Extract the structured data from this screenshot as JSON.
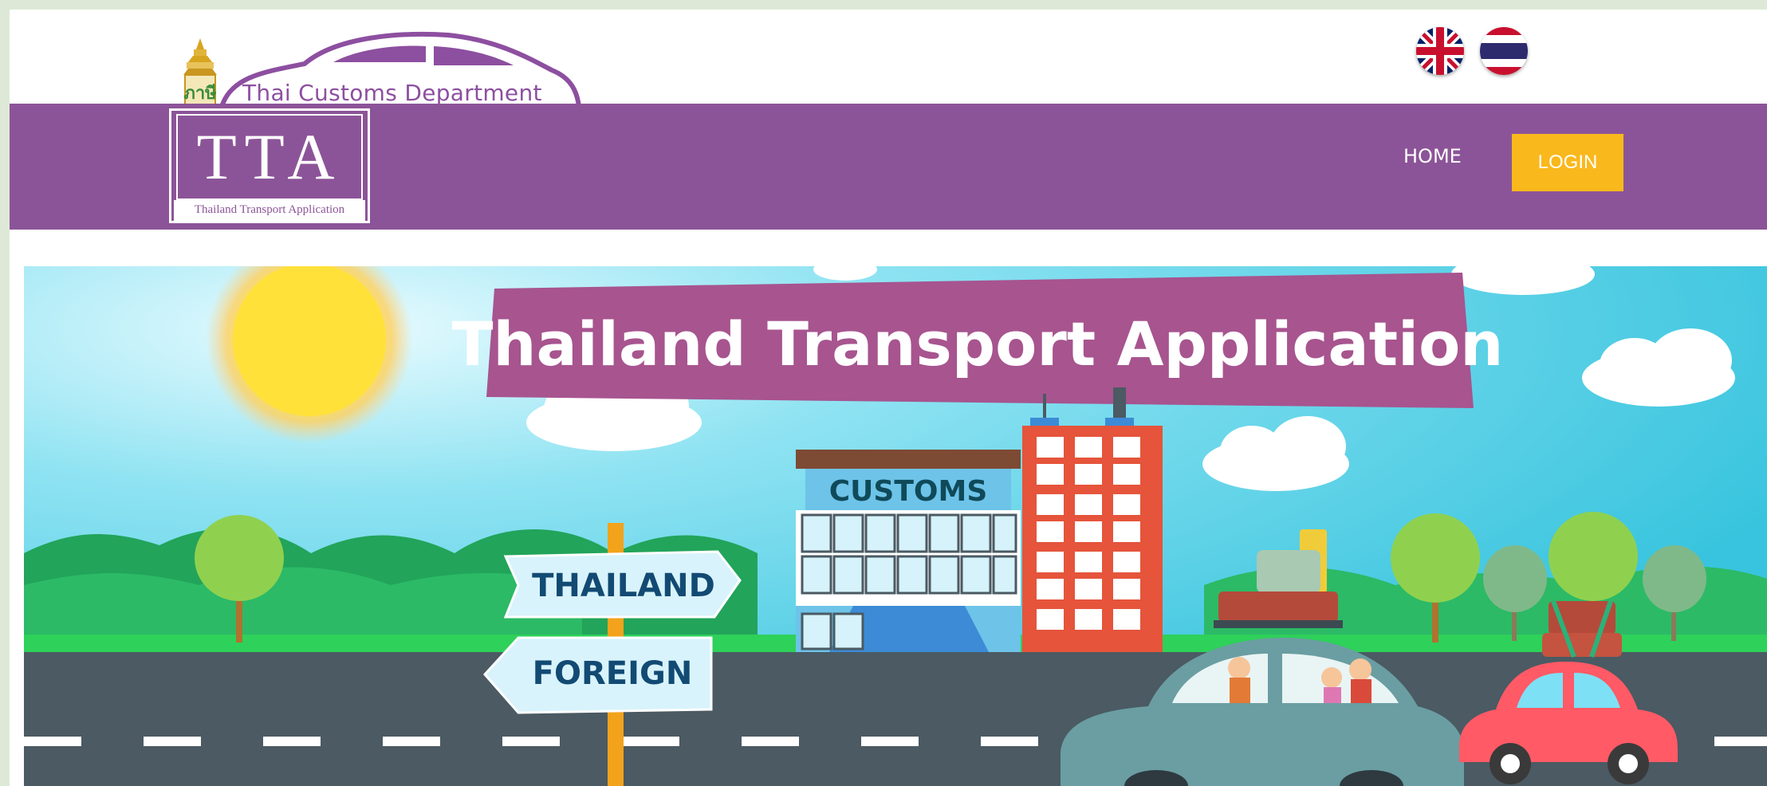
{
  "header": {
    "department_name": "Thai Customs Department",
    "emblem_text": "ภาษี",
    "languages": [
      {
        "code": "en",
        "icon": "uk-flag-icon"
      },
      {
        "code": "th",
        "icon": "thai-flag-icon"
      }
    ]
  },
  "nav": {
    "logo_main": "TTA",
    "logo_sub": "Thailand Transport Application",
    "home_label": "HOME",
    "login_label": "LOGIN"
  },
  "banner": {
    "title": "Thailand Transport Application",
    "building_sign": "CUSTOMS",
    "sign_top": "THAILAND",
    "sign_bottom": "FOREIGN"
  },
  "colors": {
    "brand_purple": "#8c5498",
    "login_yellow": "#f9b81b",
    "sky": "#46c8e0",
    "road": "#4b5a63"
  }
}
